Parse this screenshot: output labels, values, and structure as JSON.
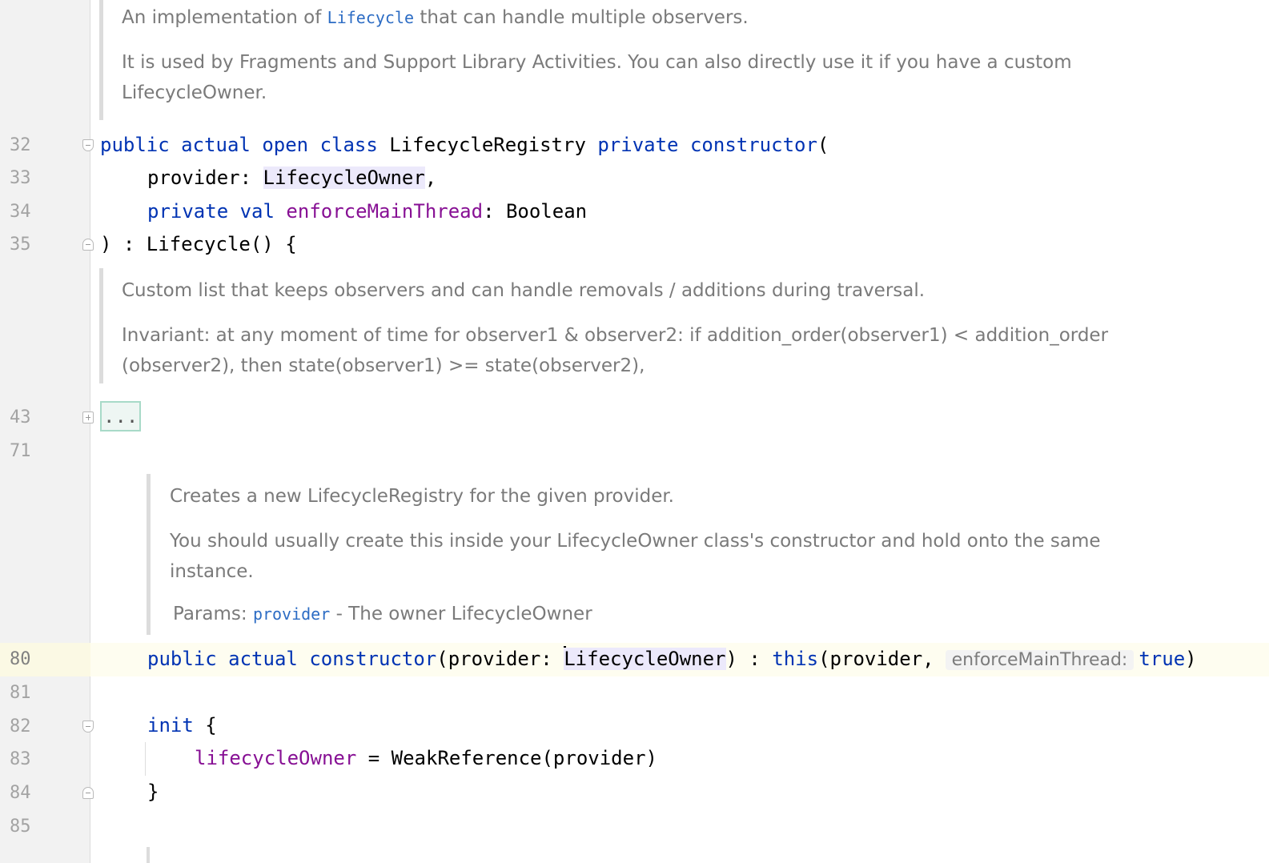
{
  "gutter": {
    "line_numbers": [
      "32",
      "33",
      "34",
      "35",
      "43",
      "71",
      "80",
      "81",
      "82",
      "83",
      "84",
      "85"
    ]
  },
  "doc_class": {
    "p1_before": "An implementation of ",
    "p1_code": "Lifecycle",
    "p1_after": " that can handle multiple observers.",
    "p2_line1": "It is used by Fragments and Support Library Activities. You can also directly use it if you have a custom",
    "p2_line2": "LifecycleOwner."
  },
  "code_header": {
    "l32": {
      "public": "public",
      "actual": "actual",
      "open": "open",
      "class": "class",
      "name": " LifecycleRegistry ",
      "private": "private",
      "constructor": "constructor",
      "paren": "("
    },
    "l33": {
      "param": "provider: ",
      "type": "LifecycleOwner",
      "comma": ","
    },
    "l34": {
      "private": "private",
      "val": "val",
      "prop": "enforceMainThread",
      "rest": ": Boolean"
    },
    "l35": {
      "text": ") : Lifecycle() {"
    }
  },
  "doc_observer": {
    "p1": "Custom list that keeps observers and can handle removals / additions during traversal.",
    "p2_line1": "Invariant: at any moment of time for observer1 & observer2: if addition_order(observer1) < addition_order",
    "p2_line2": "(observer2), then state(observer1) >= state(observer2),"
  },
  "folded_region": {
    "text": "..."
  },
  "doc_constructor": {
    "p1": "Creates a new LifecycleRegistry for the given provider.",
    "p2_line1": "You should usually create this inside your LifecycleOwner class's constructor and hold onto the same",
    "p2_line2": "instance.",
    "params_label": "Params: ",
    "params_code": "provider",
    "params_desc": " - The owner LifecycleOwner"
  },
  "code_ctor": {
    "public": "public",
    "actual": "actual",
    "constructor": "constructor",
    "open_param": "(provider: ",
    "type": "LifecycleOwner",
    "mid": ") : ",
    "this": "this",
    "args": "(provider,",
    "hint": "enforceMainThread:",
    "true": "true",
    "close": ")"
  },
  "code_init": {
    "init": "init",
    "brace_open": " {",
    "prop": "lifecycleOwner",
    "assign": " = WeakReference(provider)",
    "brace_close": "}"
  },
  "colors": {
    "keyword": "#0033b3",
    "property": "#871094",
    "doc_text": "#7a7a7a",
    "doc_code": "#2c6cc4",
    "current_line": "#fefdf0",
    "gutter": "#f2f2f2"
  }
}
